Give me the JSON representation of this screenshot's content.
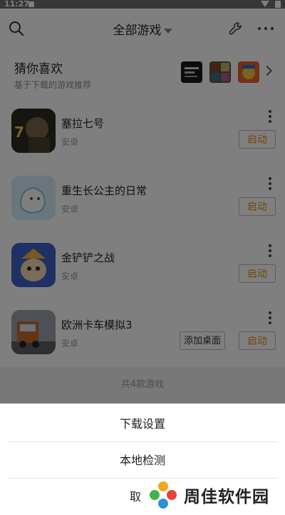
{
  "status_bar": {
    "time": "11:27"
  },
  "header": {
    "title": "全部游戏"
  },
  "recommend": {
    "title": "猜你喜欢",
    "subtitle": "基于下载的游戏推荐"
  },
  "games": [
    {
      "name": "塞拉七号",
      "platform": "安卓",
      "launch_label": "启动"
    },
    {
      "name": "重生长公主的日常",
      "platform": "安卓",
      "launch_label": "启动"
    },
    {
      "name": "金铲铲之战",
      "platform": "安卓",
      "launch_label": "启动"
    },
    {
      "name": "欧洲卡车模拟3",
      "platform": "安卓",
      "launch_label": "启动",
      "extra_label": "添加桌面"
    }
  ],
  "footer": {
    "count_text": "共4款游戏"
  },
  "sheet": {
    "items": [
      "下载设置",
      "本地检测"
    ],
    "cancel_partial": "取"
  },
  "watermark": {
    "text": "周佳软件园"
  },
  "colors": {
    "accent": "#e98a1c",
    "overlay": "rgba(0,0,0,0.5)"
  }
}
